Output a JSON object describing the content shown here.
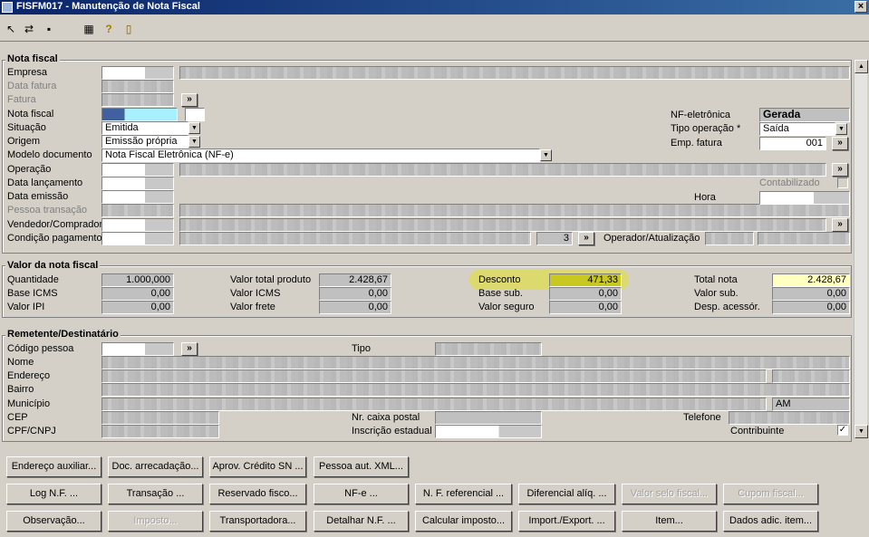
{
  "window": {
    "title": "FISFM017 - Manutenção de Nota Fiscal",
    "close_glyph": "×"
  },
  "toolbar": {
    "icons": [
      "exit-icon",
      "refresh-icon",
      "save-icon",
      "calculator-icon",
      "help-icon",
      "door-icon"
    ]
  },
  "nota_fiscal": {
    "title": "Nota fiscal",
    "empresa_label": "Empresa",
    "data_fatura_label": "Data fatura",
    "fatura_label": "Fatura",
    "nota_fiscal_label": "Nota fiscal",
    "situacao_label": "Situação",
    "situacao_value": "Emitida",
    "origem_label": "Origem",
    "origem_value": "Emissão própria",
    "modelo_label": "Modelo documento",
    "modelo_value": "Nota Fiscal Eletrônica (NF-e)",
    "operacao_label": "Operação",
    "data_lancamento_label": "Data lançamento",
    "data_emissao_label": "Data emissão",
    "pessoa_transacao_label": "Pessoa transação",
    "vendedor_label": "Vendedor/Comprador",
    "condicao_label": "Condição pagamento",
    "condicao_count": "3",
    "operador_label": "Operador/Atualização",
    "nfe_label": "NF-eletrônica",
    "nfe_value": "Gerada",
    "tipo_operacao_label": "Tipo operação *",
    "tipo_operacao_value": "Saída",
    "emp_fatura_label": "Emp. fatura",
    "emp_fatura_value": "001",
    "contabilizado_label": "Contabilizado",
    "hora_label": "Hora"
  },
  "valor": {
    "title": "Valor da nota fiscal",
    "quantidade_label": "Quantidade",
    "quantidade_value": "1.000,000",
    "base_icms_label": "Base ICMS",
    "base_icms_value": "0,00",
    "valor_ipi_label": "Valor IPI",
    "valor_ipi_value": "0,00",
    "valor_total_produto_label": "Valor total produto",
    "valor_total_produto_value": "2.428,67",
    "valor_icms_label": "Valor ICMS",
    "valor_icms_value": "0,00",
    "valor_frete_label": "Valor frete",
    "valor_frete_value": "0,00",
    "desconto_label": "Desconto",
    "desconto_value": "471,33",
    "base_sub_label": "Base sub.",
    "base_sub_value": "0,00",
    "valor_seguro_label": "Valor seguro",
    "valor_seguro_value": "0,00",
    "total_nota_label": "Total nota",
    "total_nota_value": "2.428,67",
    "valor_sub_label": "Valor sub.",
    "valor_sub_value": "0,00",
    "desp_acessor_label": "Desp. acessór.",
    "desp_acessor_value": "0,00"
  },
  "remetente": {
    "title": "Remetente/Destinatário",
    "codigo_label": "Código pessoa",
    "tipo_label": "Tipo",
    "nome_label": "Nome",
    "endereco_label": "Endereço",
    "bairro_label": "Bairro",
    "municipio_label": "Município",
    "uf_value": "AM",
    "cep_label": "CEP",
    "caixa_postal_label": "Nr. caixa postal",
    "telefone_label": "Telefone",
    "cpf_label": "CPF/CNPJ",
    "inscricao_label": "Inscrição estadual",
    "contribuinte_label": "Contribuinte",
    "contribuinte_check": "✓"
  },
  "buttons": {
    "row1": [
      "Endereço auxiliar...",
      "Doc. arrecadação...",
      "Aprov. Crédito SN ...",
      "Pessoa aut. XML..."
    ],
    "row2": [
      "Log N.F. ...",
      "Transação ...",
      "Reservado fisco...",
      "NF-e ...",
      "N. F. referencial ...",
      "Diferencial alíq. ...",
      "Valor selo fiscal...",
      "Cupom fiscal..."
    ],
    "row3": [
      "Observação...",
      "Imposto...",
      "Transportadora...",
      "Detalhar N.F. ...",
      "Calcular imposto...",
      "Import./Export. ...",
      "Item...",
      "Dados adic. item..."
    ]
  },
  "glyphs": {
    "more": "»",
    "down": "▼",
    "up": "▲"
  }
}
